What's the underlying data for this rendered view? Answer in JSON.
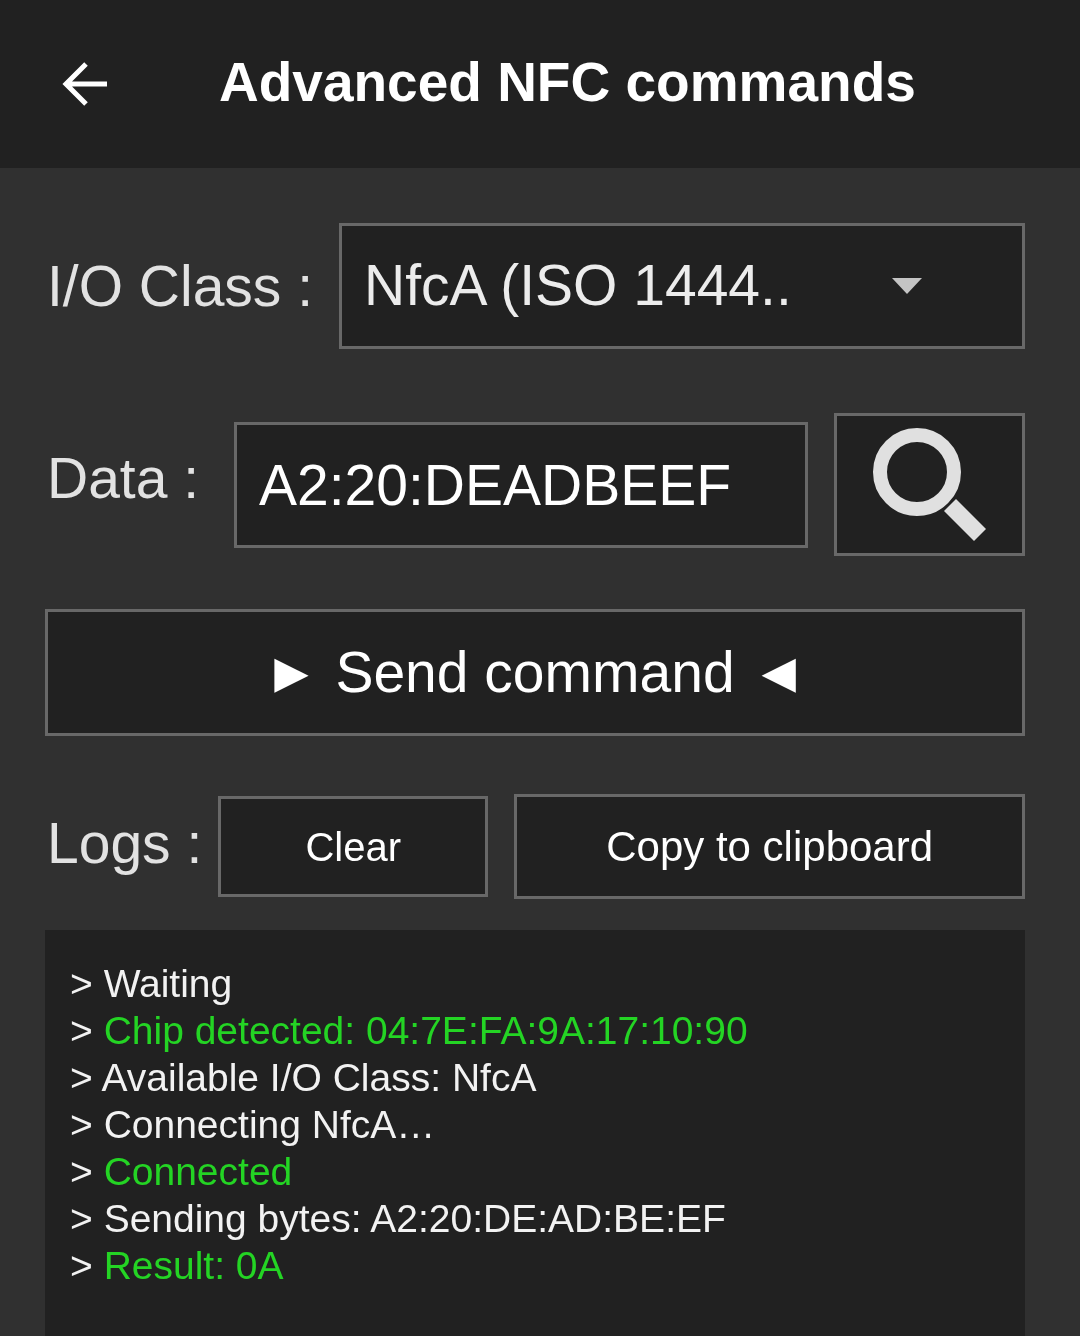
{
  "app_bar": {
    "title": "Advanced NFC commands"
  },
  "io_class": {
    "label": "I/O Class :",
    "value": "NfcA (ISO 1444.."
  },
  "data": {
    "label": "Data :",
    "value": "A2:20:DEADBEEF"
  },
  "send_button": {
    "label": "► Send command ◄"
  },
  "logs": {
    "label": "Logs :",
    "buttons": [
      "Clear",
      "Copy to clipboard"
    ],
    "lines": [
      {
        "prompt": ">",
        "message": "Waiting",
        "kind": "info"
      },
      {
        "prompt": ">",
        "message": "Chip detected: 04:7E:FA:9A:17:10:90",
        "kind": "success"
      },
      {
        "prompt": ">",
        "message": "Available I/O Class: NfcA",
        "kind": "info"
      },
      {
        "prompt": ">",
        "message": "Connecting NfcA…",
        "kind": "info"
      },
      {
        "prompt": ">",
        "message": "Connected",
        "kind": "success"
      },
      {
        "prompt": ">",
        "message": "Sending bytes: A2:20:DE:AD:BE:EF",
        "kind": "info"
      },
      {
        "prompt": ">",
        "message": "Result: 0A",
        "kind": "success"
      }
    ]
  }
}
